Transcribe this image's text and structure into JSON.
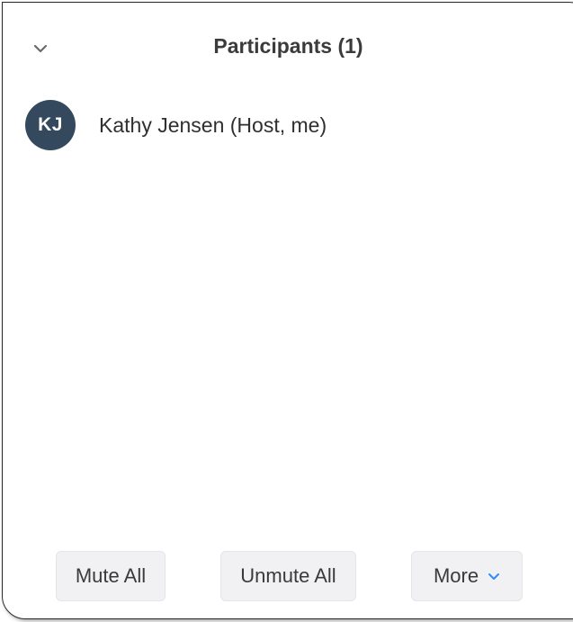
{
  "header": {
    "title": "Participants (1)",
    "collapse_icon": "chevron-down-icon"
  },
  "participants": [
    {
      "initials": "KJ",
      "name": "Kathy Jensen (Host, me)",
      "avatar_color": "#34495e"
    }
  ],
  "footer": {
    "mute_all_label": "Mute All",
    "unmute_all_label": "Unmute All",
    "more_label": "More",
    "more_icon": "chevron-down-icon",
    "accent_color": "#2d8cff"
  }
}
